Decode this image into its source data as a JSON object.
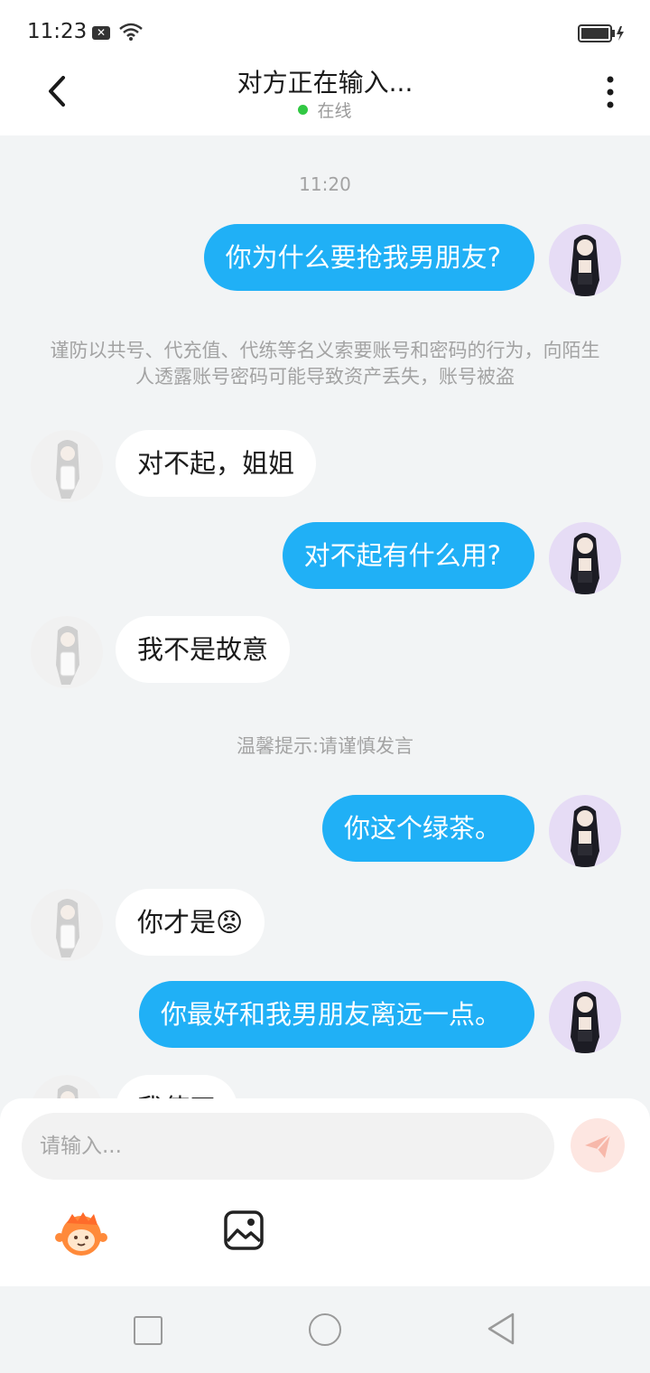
{
  "status_bar": {
    "time": "11:23"
  },
  "header": {
    "title": "对方正在输入...",
    "online": "在线"
  },
  "chat": {
    "time_1": "11:20",
    "msg_1": "你为什么要抢我男朋友?",
    "notice": "谨防以共号、代充值、代练等名义索要账号和密码的行为，向陌生人透露账号密码可能导致资产丢失，账号被盗",
    "msg_2": "对不起，姐姐",
    "msg_3": "对不起有什么用?",
    "msg_4": "我不是故意",
    "hint": "温馨提示:请谨慎发言",
    "msg_5": "你这个绿茶。",
    "msg_6": "你才是😡",
    "msg_7": "你最好和我男朋友离远一点。",
    "msg_8_partial": "我使四"
  },
  "composer": {
    "placeholder": "请输入..."
  },
  "colors": {
    "my_bubble": "#20b0f6",
    "other_bubble": "#ffffff",
    "online": "#31c843",
    "send_button": "#fde6e1"
  },
  "icons": [
    "back-arrow-icon",
    "more-vertical-icon",
    "wifi-icon",
    "battery-icon",
    "send-icon",
    "emoji-icon",
    "image-icon"
  ]
}
